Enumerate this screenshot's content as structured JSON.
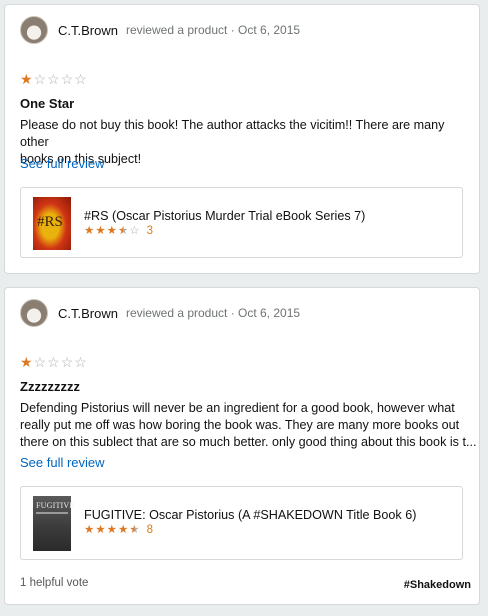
{
  "reviews": [
    {
      "author": "C.T.Brown",
      "meta": "reviewed a product · Oct 6, 2015",
      "rating": 1,
      "title": "One Star",
      "body_line1": "Please do not buy this book! The author attacks the vicitim!! There are many other",
      "body_line2": "books on this subject!",
      "see_full": "See full review",
      "product": {
        "title": "#RS (Oscar Pistorius Murder Trial eBook Series 7)",
        "rating": 3.5,
        "count": "3",
        "cover_text": "#RS"
      }
    },
    {
      "author": "C.T.Brown",
      "meta": "reviewed a product · Oct 6, 2015",
      "rating": 1,
      "title": "Zzzzzzzzz",
      "body_line1": "Defending Pistorius will never be an ingredient for a good book, however what",
      "body_line2": "really put me off was how boring the book was. They are many more books out",
      "body_line3": "there on this sublect that are so much better. only good thing about this book is t...",
      "see_full": "See full review",
      "product": {
        "title": "FUGITIVE: Oscar Pistorius (A #SHAKEDOWN Title Book 6)",
        "rating": 4.5,
        "count": "8",
        "cover_text": "FUGITIVE"
      },
      "helpful": "1 helpful vote"
    }
  ],
  "hashtag": "#Shakedown",
  "colors": {
    "star": "#de7921",
    "link": "#0066c0",
    "muted": "#6f7373"
  }
}
